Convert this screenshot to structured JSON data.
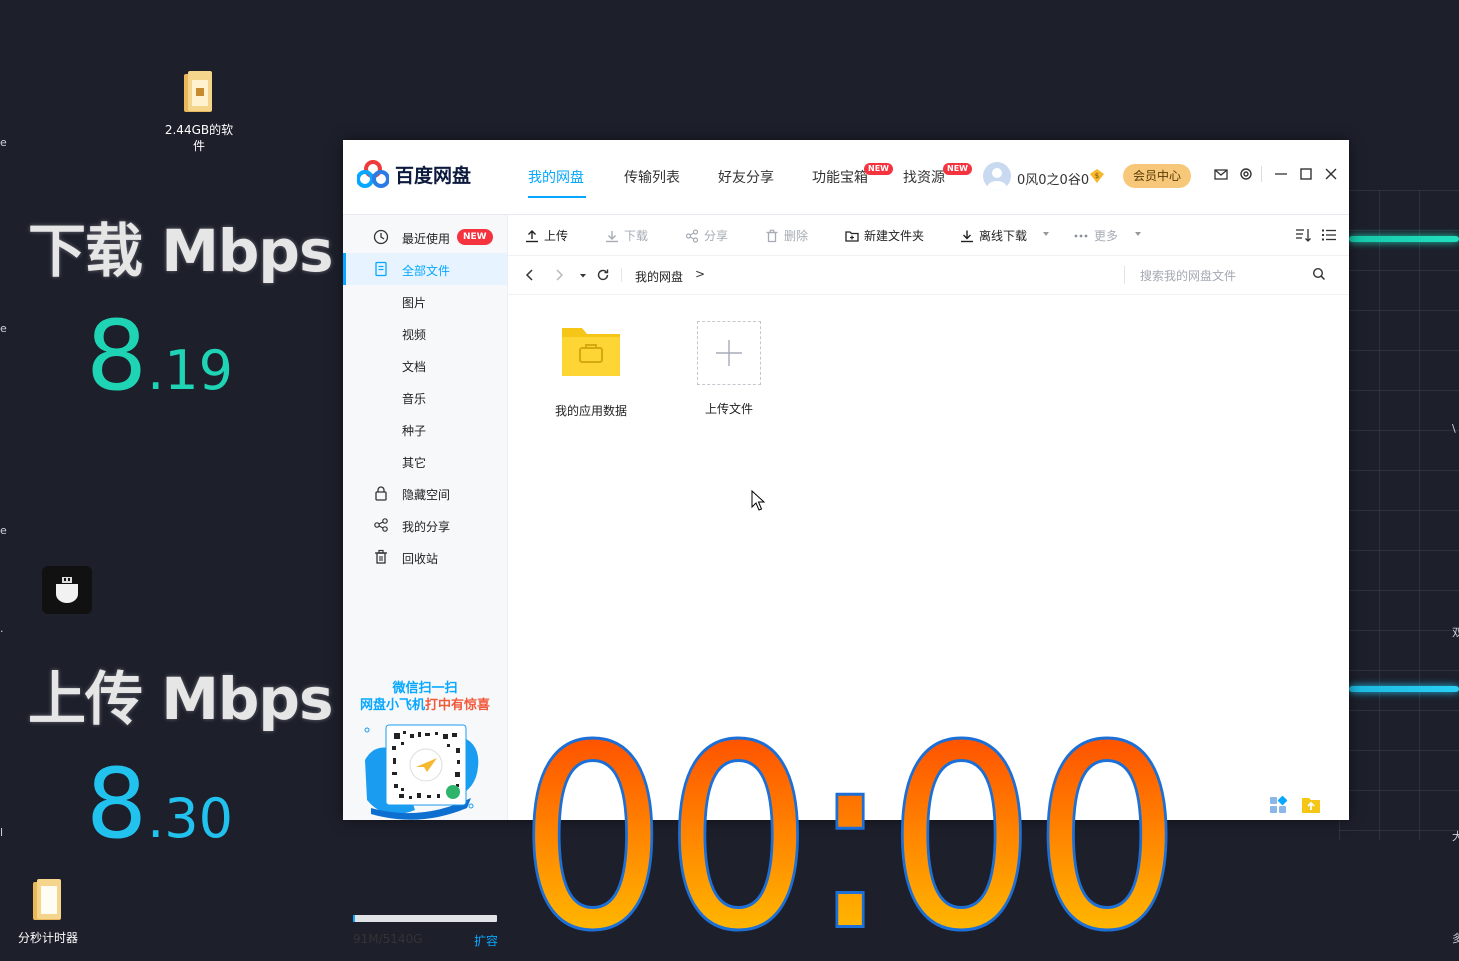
{
  "desktop": {
    "icons": [
      {
        "label_line1": "2.44GB的软",
        "label_line2": "件"
      },
      {
        "label_line1": "分秒计时器",
        "label_line2": ""
      }
    ],
    "edge_fragments": [
      "e",
      "e",
      "e",
      ".",
      "l"
    ],
    "right_fragments": [
      "\\",
      "双",
      "大",
      "多"
    ],
    "download_label": "下载 Mbps",
    "download_int": "8",
    "download_frac": ".19",
    "upload_label": "上传 Mbps",
    "upload_int": "8",
    "upload_frac": ".30",
    "timer_text": "00:00",
    "colors": {
      "background": "#1d1f2b",
      "download_value": "#1fd4b4",
      "upload_value": "#21c3ee",
      "timer_top": "#ff3c00",
      "timer_bottom": "#ffd200",
      "timer_outline": "#1b6fd6"
    }
  },
  "app": {
    "title": "百度网盘",
    "tabs": [
      {
        "label": "我的网盘",
        "active": true
      },
      {
        "label": "传输列表"
      },
      {
        "label": "好友分享"
      },
      {
        "label": "功能宝箱",
        "badge": "NEW"
      },
      {
        "label": "找资源",
        "badge": "NEW"
      }
    ],
    "user": {
      "name": "0风0之0谷0"
    },
    "vip_button": "会员中心",
    "sidebar": {
      "items": [
        {
          "label": "最近使用",
          "badge": "NEW",
          "icon": "clock-icon"
        },
        {
          "label": "全部文件",
          "icon": "file-icon",
          "active": true
        },
        {
          "label": "图片"
        },
        {
          "label": "视频"
        },
        {
          "label": "文档"
        },
        {
          "label": "音乐"
        },
        {
          "label": "种子"
        },
        {
          "label": "其它"
        },
        {
          "label": "隐藏空间",
          "icon": "lock-icon"
        },
        {
          "label": "我的分享",
          "icon": "share-icon"
        },
        {
          "label": "回收站",
          "icon": "trash-icon"
        }
      ],
      "promo_line1": "微信扫一扫",
      "promo_line2_blue": "网盘小飞机",
      "promo_line2_red": "打中有惊喜",
      "storage": "91M/5140G",
      "storage_used_fraction": 2e-05,
      "expand": "扩容"
    },
    "toolbar": {
      "upload": "上传",
      "download": "下载",
      "share": "分享",
      "delete": "删除",
      "new_folder": "新建文件夹",
      "offline_download": "离线下载",
      "more": "更多"
    },
    "breadcrumb": {
      "root": "我的网盘",
      "sep": ">"
    },
    "search": {
      "placeholder": "搜索我的网盘文件"
    },
    "files": [
      {
        "name": "我的应用数据",
        "type": "folder"
      },
      {
        "name": "上传文件",
        "type": "upload"
      }
    ],
    "accent": "#06a7ff"
  }
}
